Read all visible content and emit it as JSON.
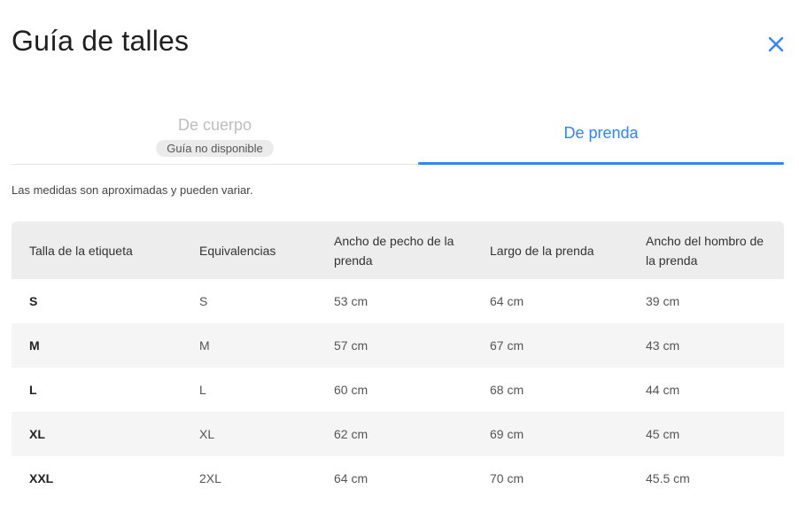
{
  "modal": {
    "title": "Guía de talles",
    "close_icon": "close-icon",
    "accent_color": "#3483fa"
  },
  "tabs": [
    {
      "label": "De cuerpo",
      "badge": "Guía no disponible",
      "active": false
    },
    {
      "label": "De prenda",
      "active": true
    }
  ],
  "note": "Las medidas son aproximadas y pueden variar.",
  "table": {
    "headers": [
      "Talla de la etiqueta",
      "Equivalencias",
      "Ancho de pecho de la prenda",
      "Largo de la prenda",
      "Ancho del hombro de la prenda"
    ],
    "rows": [
      [
        "S",
        "S",
        "53 cm",
        "64 cm",
        "39 cm"
      ],
      [
        "M",
        "M",
        "57 cm",
        "67 cm",
        "43 cm"
      ],
      [
        "L",
        "L",
        "60 cm",
        "68 cm",
        "44 cm"
      ],
      [
        "XL",
        "XL",
        "62 cm",
        "69 cm",
        "45 cm"
      ],
      [
        "XXL",
        "2XL",
        "64 cm",
        "70 cm",
        "45.5 cm"
      ]
    ]
  }
}
